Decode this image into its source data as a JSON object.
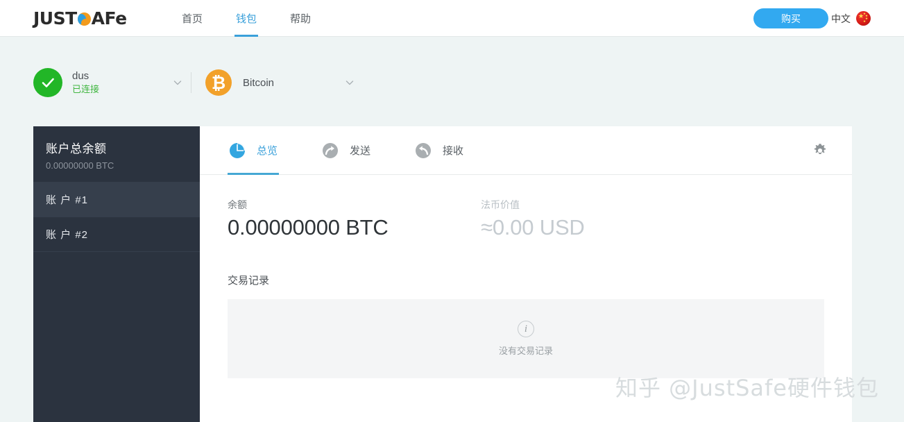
{
  "header": {
    "logo_text_1": "JUST",
    "logo_mark": "s-circle-mark",
    "logo_text_2": "AFe",
    "nav": [
      {
        "label": "首页",
        "active": false
      },
      {
        "label": "钱包",
        "active": true
      },
      {
        "label": "帮助",
        "active": false
      }
    ],
    "buy_button": "购买",
    "language": "中文",
    "flag": "china-flag"
  },
  "selectors": {
    "device": {
      "name": "dus",
      "status": "已连接",
      "status_color": "#3fb63f",
      "check_color": "#22b627"
    },
    "coin": {
      "name": "Bitcoin",
      "symbol": "₿",
      "color": "#f2a12a"
    }
  },
  "sidebar": {
    "total_label": "账户总余额",
    "total_value": "0.00000000 BTC",
    "accounts": [
      {
        "label": "账 户 #1",
        "active": true
      },
      {
        "label": "账 户 #2",
        "active": false
      }
    ]
  },
  "tabs": [
    {
      "label": "总览",
      "icon": "pie-chart-icon",
      "active": true
    },
    {
      "label": "发送",
      "icon": "send-arrow-icon",
      "active": false
    },
    {
      "label": "接收",
      "icon": "receive-arrow-icon",
      "active": false
    }
  ],
  "settings_icon": "gear-icon",
  "balance": {
    "label": "余额",
    "value": "0.00000000 BTC",
    "fiat_label": "法币价值",
    "fiat_value": "≈0.00 USD"
  },
  "transactions": {
    "title": "交易记录",
    "empty_icon": "info-icon",
    "empty_text": "没有交易记录"
  },
  "watermark": "知乎 @JustSafe硬件钱包",
  "colors": {
    "page_bg": "#eef4f4",
    "accent_blue": "#3aa0da",
    "buy_blue": "#32a9f0",
    "sidebar_bg": "#2b333f",
    "sidebar_active": "#363f4c",
    "bitcoin_orange": "#f2a12a",
    "connected_green": "#22b627"
  }
}
